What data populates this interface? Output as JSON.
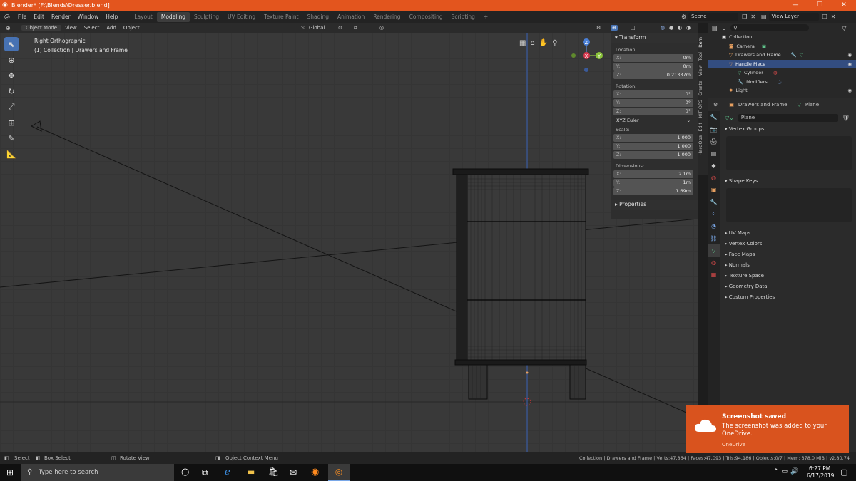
{
  "window": {
    "title": "Blender* [F:\\Blends\\Dresser.blend]",
    "controls": [
      "—",
      "☐",
      "✕"
    ]
  },
  "menubar": {
    "menus": [
      "File",
      "Edit",
      "Render",
      "Window",
      "Help"
    ],
    "workspaces": [
      "Layout",
      "Modeling",
      "Sculpting",
      "UV Editing",
      "Texture Paint",
      "Shading",
      "Animation",
      "Rendering",
      "Compositing",
      "Scripting"
    ],
    "active_workspace": "Modeling",
    "add_tab": "+",
    "scene_label": "Scene",
    "view_layer_label": "View Layer"
  },
  "viewport_header": {
    "mode": "Object Mode",
    "menus": [
      "View",
      "Select",
      "Add",
      "Object"
    ],
    "orientation": "Global"
  },
  "viewport": {
    "view_name": "Right Orthographic",
    "collection_info": "(1) Collection | Drawers and Frame",
    "gizmo": {
      "z": "Z",
      "y": "Y",
      "x": "X"
    }
  },
  "npanel": {
    "transform_title": "Transform",
    "location_label": "Location:",
    "location": [
      {
        "k": "X:",
        "v": "0m"
      },
      {
        "k": "Y:",
        "v": "0m"
      },
      {
        "k": "Z:",
        "v": "0.21337m"
      }
    ],
    "rotation_label": "Rotation:",
    "rotation": [
      {
        "k": "X:",
        "v": "0°"
      },
      {
        "k": "Y:",
        "v": "0°"
      },
      {
        "k": "Z:",
        "v": "0°"
      }
    ],
    "rotation_mode": "XYZ Euler",
    "scale_label": "Scale:",
    "scale": [
      {
        "k": "X:",
        "v": "1.000"
      },
      {
        "k": "Y:",
        "v": "1.000"
      },
      {
        "k": "Z:",
        "v": "1.000"
      }
    ],
    "dimensions_label": "Dimensions:",
    "dimensions": [
      {
        "k": "X:",
        "v": "2.1m"
      },
      {
        "k": "Y:",
        "v": "1m"
      },
      {
        "k": "Z:",
        "v": "1.69m"
      }
    ],
    "properties_title": "Properties"
  },
  "side_tabs": [
    "Item",
    "Tool",
    "View",
    "Create",
    "KIT OPS",
    "Edit",
    "HardOps"
  ],
  "outliner": {
    "rows": [
      {
        "label": "Collection",
        "indent": 1,
        "selected": false
      },
      {
        "label": "Camera",
        "indent": 2,
        "selected": false
      },
      {
        "label": "Drawers and Frame",
        "indent": 2,
        "selected": false
      },
      {
        "label": "Handle Piece",
        "indent": 2,
        "selected": true
      },
      {
        "label": "Cylinder",
        "indent": 3,
        "selected": false
      },
      {
        "label": "Modifiers",
        "indent": 3,
        "selected": false
      },
      {
        "label": "Light",
        "indent": 2,
        "selected": false
      }
    ]
  },
  "properties": {
    "breadcrumb_object": "Drawers and Frame",
    "breadcrumb_data": "Plane",
    "mesh_name": "Plane",
    "vertex_groups": "Vertex Groups",
    "shape_keys": "Shape Keys",
    "collapsed_sections": [
      "UV Maps",
      "Vertex Colors",
      "Face Maps",
      "Normals",
      "Texture Space",
      "Geometry Data",
      "Custom Properties"
    ]
  },
  "statusbar": {
    "select": "Select",
    "box_select": "Box Select",
    "rotate_view": "Rotate View",
    "context_menu": "Object Context Menu",
    "stats": "Collection | Drawers and Frame | Verts:47,864 | Faces:47,093 | Tris:94,186 | Objects:0/7 | Mem: 378.0 MiB | v2.80.74"
  },
  "toast": {
    "title": "Screenshot saved",
    "body": "The screenshot was added to your OneDrive.",
    "source": "OneDrive"
  },
  "taskbar": {
    "search_placeholder": "Type here to search",
    "time": "6:27 PM",
    "date": "6/17/2019"
  },
  "colors": {
    "accent_blue": "#4772b3",
    "title_orange": "#e3551e",
    "toast_orange": "#d9531e",
    "outliner_selected": "#334d80"
  }
}
